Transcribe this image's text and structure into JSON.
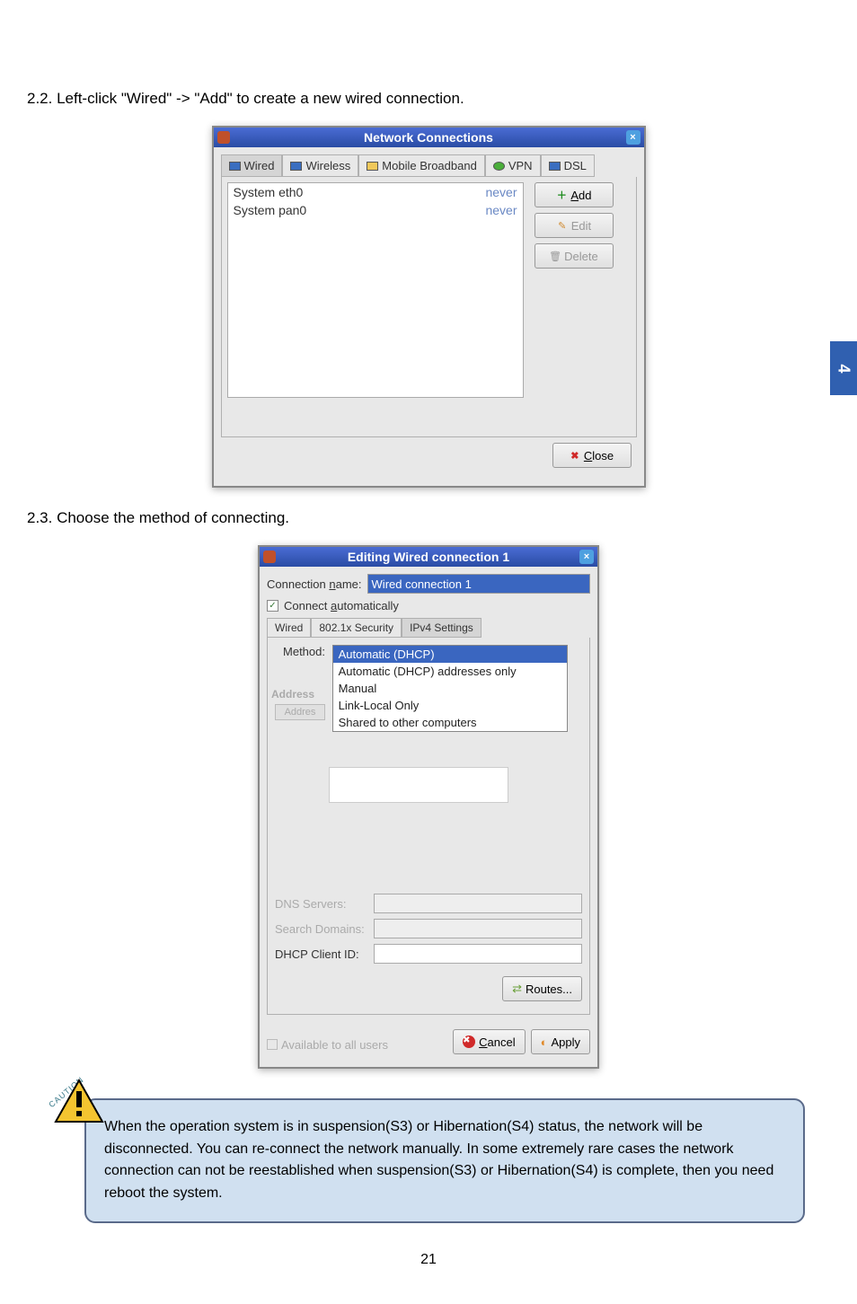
{
  "steps": {
    "s22": "2.2. Left-click \"Wired\" -> \"Add\" to create a new wired connection.",
    "s23": "2.3. Choose the method of connecting."
  },
  "win1": {
    "title": "Network Connections",
    "tabs": {
      "wired": "Wired",
      "wireless": "Wireless",
      "mobile": "Mobile Broadband",
      "vpn": "VPN",
      "dsl": "DSL"
    },
    "rows": [
      {
        "name": "System eth0",
        "status": "never"
      },
      {
        "name": "System pan0",
        "status": "never"
      }
    ],
    "buttons": {
      "add": "Add",
      "edit": "Edit",
      "delete": "Delete",
      "close": "Close"
    }
  },
  "win2": {
    "title": "Editing Wired connection 1",
    "conn_name_label": "Connection name:",
    "conn_name_value": "Wired connection 1",
    "connect_auto": "Connect automatically",
    "tabs": {
      "wired": "Wired",
      "sec": "802.1x Security",
      "ipv4": "IPv4 Settings"
    },
    "method_label": "Method:",
    "method_options": {
      "auto": "Automatic (DHCP)",
      "auto_addr": "Automatic (DHCP) addresses only",
      "manual": "Manual",
      "link": "Link-Local Only",
      "shared": "Shared to other computers"
    },
    "address_label": "Address",
    "address_col": "Addres",
    "dns": "DNS Servers:",
    "search": "Search Domains:",
    "dhcp": "DHCP Client ID:",
    "routes": "Routes...",
    "avail": "Available to all users",
    "cancel": "Cancel",
    "apply": "Apply"
  },
  "caution": "When the operation system is in suspension(S3) or Hibernation(S4) status, the network will be disconnected. You can re-connect the network manually. In some extremely rare cases the network connection can not be reestablished when suspension(S3) or Hibernation(S4) is complete, then you need reboot the system.",
  "caution_label": "CAUTION",
  "sidetab": "4",
  "page": "21"
}
